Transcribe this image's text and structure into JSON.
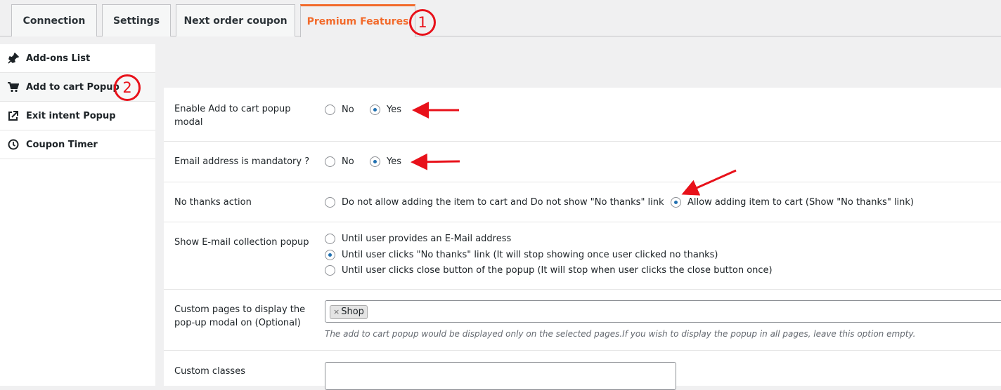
{
  "tabs": [
    {
      "label": "Connection"
    },
    {
      "label": "Settings"
    },
    {
      "label": "Next order coupon"
    },
    {
      "label": "Premium Features"
    }
  ],
  "sidebar": {
    "items": [
      {
        "label": "Add-ons List",
        "icon": "plugin-icon"
      },
      {
        "label": "Add to cart Popup",
        "icon": "cart-icon"
      },
      {
        "label": "Exit intent Popup",
        "icon": "external-link-icon"
      },
      {
        "label": "Coupon Timer",
        "icon": "clock-icon"
      }
    ]
  },
  "settings": {
    "enable_popup": {
      "label": "Enable Add to cart popup modal",
      "options": [
        "No",
        "Yes"
      ],
      "selected": "Yes"
    },
    "email_mandatory": {
      "label": "Email address is mandatory ?",
      "options": [
        "No",
        "Yes"
      ],
      "selected": "Yes"
    },
    "no_thanks": {
      "label": "No thanks action",
      "options": [
        "Do not allow adding the item to cart and Do not show \"No thanks\" link",
        "Allow adding item to cart (Show \"No thanks\" link)"
      ],
      "selected": "Allow adding item to cart (Show \"No thanks\" link)"
    },
    "email_collection": {
      "label": "Show E-mail collection popup",
      "options": [
        "Until user provides an E-Mail address",
        "Until user clicks \"No thanks\" link (It will stop showing once user clicked no thanks)",
        "Until user clicks close button of the popup (It will stop when user clicks the close button once)"
      ],
      "selected": "Until user clicks \"No thanks\" link (It will stop showing once user clicked no thanks)"
    },
    "custom_pages": {
      "label": "Custom pages to display the pop-up modal on (Optional)",
      "chip": "Shop",
      "chip_remove": "×",
      "description": "The add to cart popup would be displayed only on the selected pages.If you wish to display the popup in all pages, leave this option empty."
    },
    "custom_classes": {
      "label": "Custom classes",
      "value": ""
    }
  },
  "annotations": {
    "marker1": "1",
    "marker2": "2",
    "color": "#e8111a"
  },
  "colors": {
    "accent": "#f26a2b",
    "radio": "#2271b1"
  }
}
